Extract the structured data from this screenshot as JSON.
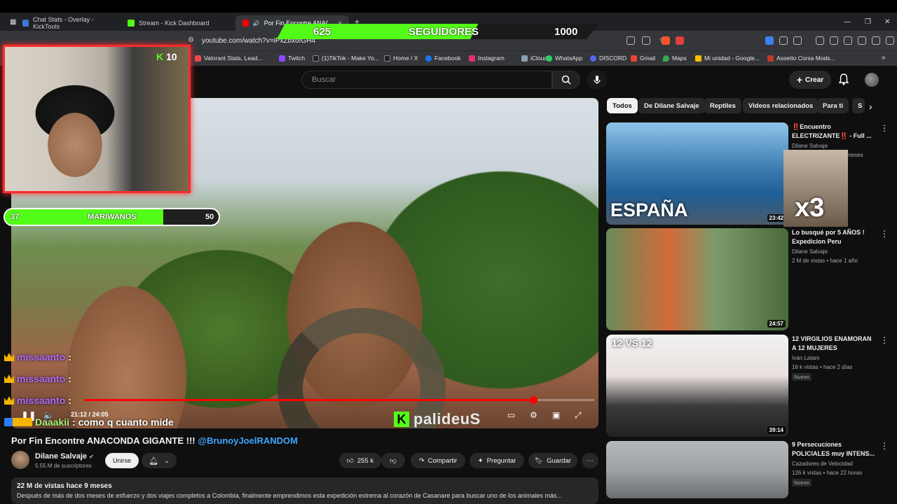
{
  "browser": {
    "tabs": [
      {
        "label": "Chat Stats - Overlay - KickTools",
        "color": "#3c78d8"
      },
      {
        "label": "Stream - Kick Dashboard",
        "color": "#53fc18"
      },
      {
        "label": "Por Fin Encontre ANACONDA",
        "color": "#ff0000"
      }
    ],
    "new_tab": "+",
    "url": "youtube.com/watch?v=iPxZbxofGH4",
    "bookmarks": [
      {
        "label": "Valorant Stats, Lead...",
        "color": "#e94b4b"
      },
      {
        "label": "Twitch",
        "color": "#9146ff"
      },
      {
        "label": "(1)TikTok - Make Yo...",
        "color": "#222222"
      },
      {
        "label": "Home / X",
        "color": "#222222"
      },
      {
        "label": "Facebook",
        "color": "#1877f2"
      },
      {
        "label": "Instagram",
        "color": "#e1306c"
      },
      {
        "label": "iCloud",
        "color": "#8aa0b4"
      },
      {
        "label": "WhatsApp",
        "color": "#25d366"
      },
      {
        "label": "DISCORD",
        "color": "#5865f2"
      },
      {
        "label": "Gmail",
        "color": "#ea4335"
      },
      {
        "label": "Maps",
        "color": "#34a853"
      },
      {
        "label": "Mi unidad - Google...",
        "color": "#fbbc04"
      },
      {
        "label": "Assetto Corsa Mods...",
        "color": "#c0392b"
      }
    ]
  },
  "overlay": {
    "followers": {
      "current": "625",
      "label": "SEGUIDORES",
      "goal": "1000",
      "progress": 0.625
    },
    "subs_goal": {
      "current": "37",
      "label": "MARIWANOS",
      "goal": "50",
      "progress": 0.74
    },
    "kick_badge": {
      "k": "K",
      "value": "10"
    },
    "chat": [
      {
        "user": "missaanto",
        "text": ":"
      },
      {
        "user": "missaanto",
        "text": ":"
      },
      {
        "user": "missaanto",
        "text": ":"
      }
    ],
    "last_message": {
      "user": "Daaakii",
      "text": ": como q cuanto mide"
    },
    "kick_brand": {
      "k": "K",
      "name": "palideuS"
    }
  },
  "youtube": {
    "search_placeholder": "Buscar",
    "create_label": "Crear",
    "player": {
      "time": "21:12 / 24:05",
      "progress": 0.88
    },
    "video_title": "Por Fin Encontre ANACONDA GIGANTE !!! ",
    "video_title_tag": "@BrunoyJoelRANDOM",
    "channel": {
      "name": "Dilane Salvaje",
      "subs": "5.55 M de suscriptores"
    },
    "join": "Unirse",
    "likes": "255 k",
    "share": "Compartir",
    "ask": "Preguntar",
    "save": "Guardar",
    "description_meta": "22 M de vistas  hace 9 meses",
    "description_text": "Después de más de dos meses de esfuerzo y dos viajes completos a Colombia, finalmente emprendimos esta expedición extrema al corazón de Casanare para buscar uno de los animales más...",
    "chips": [
      "Todos",
      "De Dilane Salvaje",
      "Reptiles",
      "Videos relacionados",
      "Para ti",
      "S"
    ],
    "recommended": [
      {
        "title": "‼️Encuentro ELECTRIZANTE‼️ - Full ...",
        "channel": "Dilane Salvaje",
        "meta": "meses",
        "duration": "23:42",
        "thumb_text": "ESPAÑA",
        "new": ""
      },
      {
        "title": "Lo busqué por 5 AÑOS ! Expedicion Peru",
        "channel": "Dilane Salvaje",
        "meta": "2 M de vistas • hace 1 año",
        "duration": "24:57",
        "thumb_text": "",
        "new": ""
      },
      {
        "title": "12 VIRGILIOS ENAMORAN A 12 MUJERES",
        "channel": "Iván Latam",
        "meta": "16 k vistas • hace 2 días",
        "duration": "39:14",
        "thumb_text": "12 VS 12",
        "new": "Nuevo"
      },
      {
        "title": "9 Persecuciones POLICIALES muy INTENS...",
        "channel": "Cazadores de Velocidad",
        "meta": "126 k vistas • hace 22 horas",
        "duration": "",
        "thumb_text": "",
        "new": "Nuevo"
      }
    ],
    "x3_overlay": "x3"
  }
}
